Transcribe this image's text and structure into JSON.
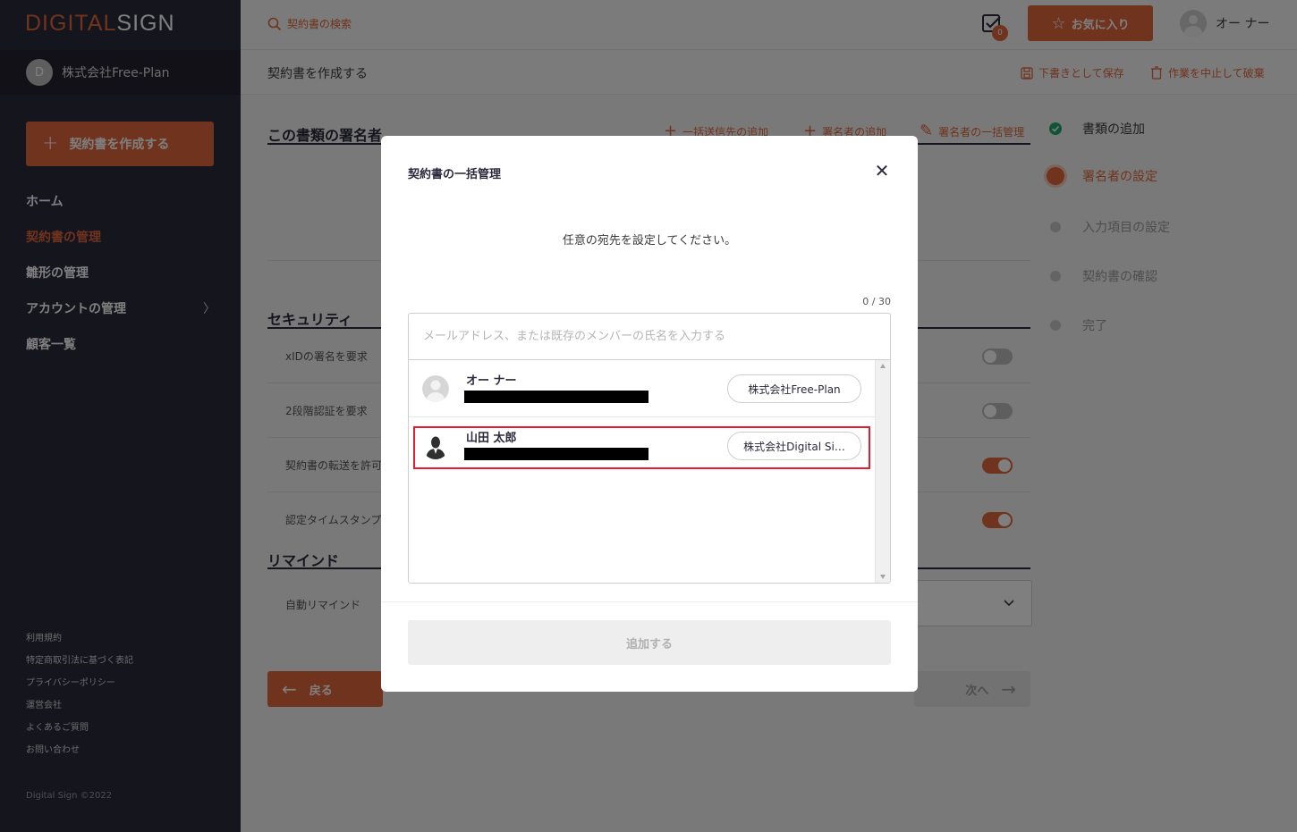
{
  "brand": {
    "logo_part1": "DIGITAL",
    "logo_part2": "SIGN"
  },
  "sidebar": {
    "company_avatar": "D",
    "company_name": "株式会社Free-Plan",
    "create_button": "契約書を作成する",
    "items": [
      {
        "label": "ホーム",
        "active": false
      },
      {
        "label": "契約書の管理",
        "active": true
      },
      {
        "label": "雛形の管理",
        "active": false
      },
      {
        "label": "アカウントの管理",
        "active": false,
        "has_chevron": true
      },
      {
        "label": "顧客一覧",
        "active": false
      }
    ],
    "footer_links": [
      "利用規約",
      "特定商取引法に基づく表記",
      "プライバシーポリシー",
      "運営会社",
      "よくあるご質問",
      "お問い合わせ"
    ],
    "copyright": "Digital Sign ©2022"
  },
  "topbar": {
    "search_placeholder": "契約書の検索",
    "task_count": "0",
    "favorite_button": "お気に入り",
    "user_name": "オー ナー"
  },
  "subbar": {
    "title": "契約書を作成する",
    "save_draft": "下書きとして保存",
    "discard": "作業を中止して破棄"
  },
  "main": {
    "signers_title": "この書類の署名者",
    "bulk_recipient_link": "一括送信先の追加",
    "add_signer_link": "署名者の追加",
    "bulk_manage_link": "署名者の一括管理",
    "security_title": "セキュリティ",
    "security_rows": [
      {
        "label": "xIDの署名を要求",
        "enabled": false
      },
      {
        "label": "2段階認証を要求",
        "enabled": false
      },
      {
        "label": "契約書の転送を許可",
        "enabled": true
      },
      {
        "label": "認定タイムスタンプ",
        "enabled": true
      }
    ],
    "remind_title": "リマインド",
    "auto_remind_label": "自動リマインド",
    "back_button": "戻る",
    "next_button": "次へ"
  },
  "steps": [
    {
      "label": "書類の追加",
      "state": "done"
    },
    {
      "label": "署名者の設定",
      "state": "current"
    },
    {
      "label": "入力項目の設定",
      "state": "pending"
    },
    {
      "label": "契約書の確認",
      "state": "pending"
    },
    {
      "label": "完了",
      "state": "pending"
    }
  ],
  "modal": {
    "title": "契約書の一括管理",
    "description": "任意の宛先を設定してください。",
    "counter": "0 / 30",
    "input_placeholder": "メールアドレス、または既存のメンバーの氏名を入力する",
    "members": [
      {
        "name": "オー ナー",
        "company": "株式会社Free-Plan"
      },
      {
        "name": "山田 太郎",
        "company": "株式会社Digital Si…"
      }
    ],
    "add_button": "追加する"
  },
  "colors": {
    "accent": "#e0663a",
    "sidebar": "#2b2a3c",
    "highlight": "#e01e2e",
    "done": "#1ea672"
  }
}
